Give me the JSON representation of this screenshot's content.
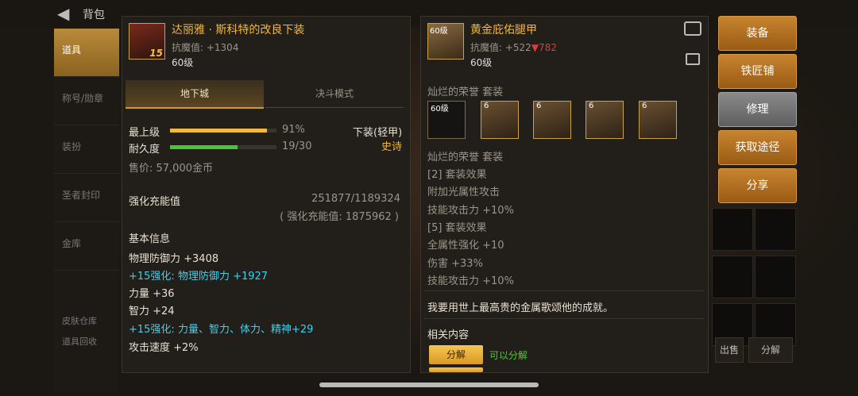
{
  "topbar": {
    "title": "背包"
  },
  "nav": {
    "items": [
      "道具",
      "称号/勋章",
      "装扮",
      "圣者封印",
      "金库"
    ],
    "bottom": [
      "皮肤仓库",
      "道具回收"
    ]
  },
  "right_bottom": {
    "sell": "出售",
    "decompose": "分解"
  },
  "left": {
    "name": "达丽雅 · 斯科特的改良下装",
    "resist": "抗魔值: +1304",
    "level": "60级",
    "badge": "15",
    "tabs": [
      "地下城",
      "决斗模式"
    ],
    "rows": {
      "top_label": "最上级",
      "top_value": "91%",
      "top_ratio": 0.91,
      "dur_label": "耐久度",
      "dur_value": "19/30",
      "dur_ratio": 0.633,
      "type": "下装(轻甲)",
      "rarity": "史诗",
      "price": "售价: 57,000金币",
      "charge_label": "强化充能值",
      "charge_value": "251877/1189324",
      "charge_sub": "( 强化充能值: 1875962 )",
      "basic_title": "基本信息",
      "l1": "物理防御力 +3408",
      "l2": "+15强化: 物理防御力 +1927",
      "l3": "力量 +36",
      "l4": "智力 +24",
      "l5": "+15强化: 力量、智力、体力、精神+29",
      "l6": "攻击速度 +2%"
    }
  },
  "right": {
    "name": "黄金庇佑腿甲",
    "resist": "抗魔值: +522",
    "resist_diff": "▼782",
    "level": "60级",
    "icon_level": "60级",
    "set_title": "灿烂的荣誉  套装",
    "slot_level": "60级",
    "slot_tag": "6",
    "lines": [
      "灿烂的荣誉  套装",
      "[2] 套装效果",
      "附加光属性攻击",
      "技能攻击力 +10%",
      "[5] 套装效果",
      "全属性强化 +10",
      "伤害 +33%",
      "技能攻击力 +10%"
    ],
    "flavor": "我要用世上最高贵的金属歌颂他的成就。",
    "related_title": "相关内容",
    "decompose_btn": "分解",
    "decompose_ok": "可以分解"
  },
  "side_buttons": [
    "装备",
    "铁匠铺",
    "修理",
    "获取途径",
    "分享"
  ],
  "colors": {
    "gold": "#f0b93a",
    "blue": "#3fd0f0",
    "red": "#e23a3a",
    "green": "#54c73a"
  }
}
